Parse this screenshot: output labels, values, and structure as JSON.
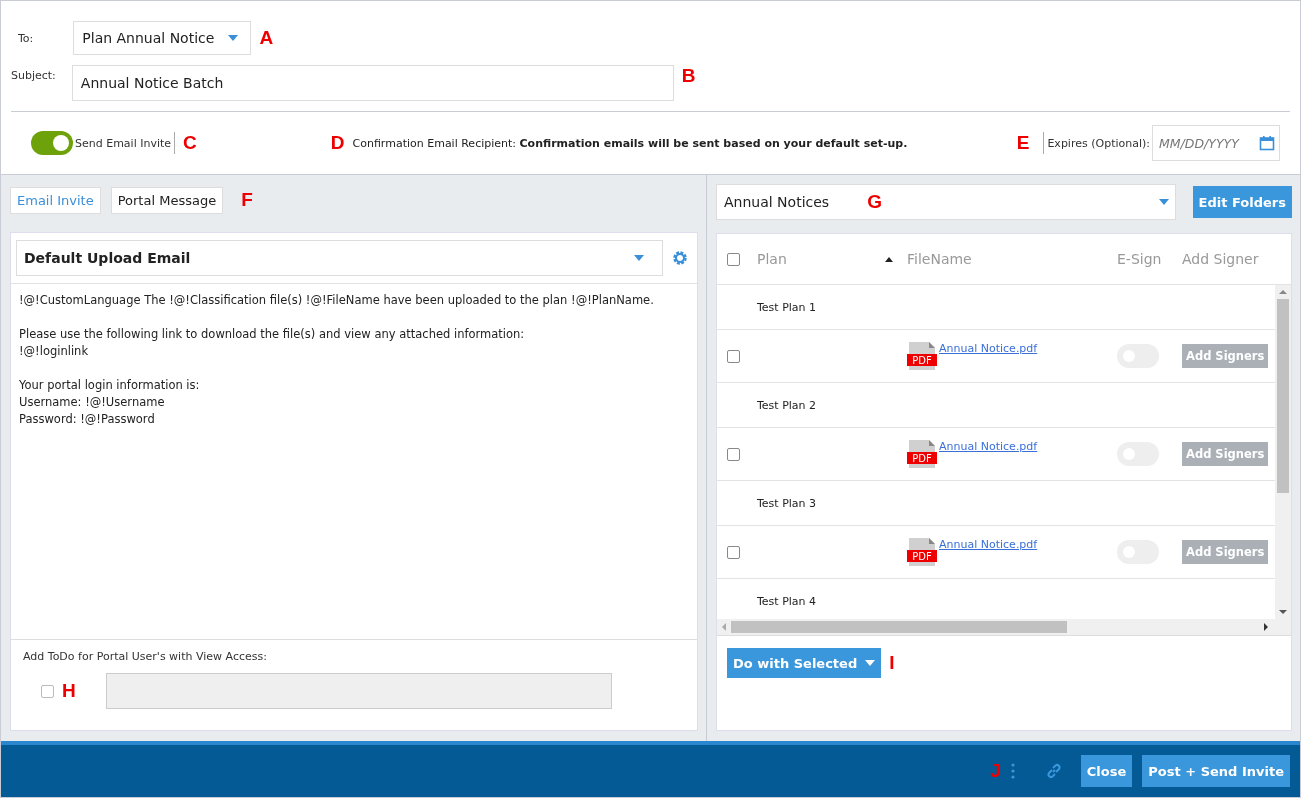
{
  "header": {
    "to_label": "To:",
    "to_value": "Plan Annual Notice",
    "subject_label": "Subject:",
    "subject_value": "Annual Notice Batch",
    "send_invite": {
      "label": "Send Email Invite",
      "on": true
    },
    "confirmation_label": "Confirmation Email Recipient:",
    "confirmation_text": "Confirmation emails will be sent based on your default set-up.",
    "expires_label": "Expires (Optional):",
    "expires_placeholder": "MM/DD/YYYY"
  },
  "callouts": [
    "A",
    "B",
    "C",
    "D",
    "E",
    "F",
    "G",
    "H",
    "I",
    "J"
  ],
  "tabs": [
    {
      "label": "Email Invite",
      "selected": true
    },
    {
      "label": "Portal Message",
      "selected": false
    }
  ],
  "template": {
    "value": "Default Upload Email",
    "body": "!@!CustomLanguage The !@!Classification file(s) !@!FileName have been uploaded to the plan !@!PlanName.\n\nPlease use the following link to download the file(s) and view any attached information:\n!@!loginlink\n\nYour portal login information is:\nUsername: !@!Username\nPassword: !@!Password"
  },
  "todo": {
    "label": "Add ToDo for Portal User's with View Access:",
    "checked": false
  },
  "folder": {
    "value": "Annual Notices",
    "edit_button": "Edit Folders"
  },
  "table": {
    "columns": [
      "Plan",
      "FileName",
      "E-Sign",
      "Add Signer"
    ],
    "select_all": false,
    "groups": [
      {
        "plan": "Test Plan 1",
        "files": [
          {
            "icon_label": "PDF",
            "filename": "Annual Notice.pdf",
            "checked": false,
            "esign": false,
            "action": "Add Signers"
          }
        ]
      },
      {
        "plan": "Test Plan 2",
        "files": [
          {
            "icon_label": "PDF",
            "filename": "Annual Notice.pdf",
            "checked": false,
            "esign": false,
            "action": "Add Signers"
          }
        ]
      },
      {
        "plan": "Test Plan 3",
        "files": [
          {
            "icon_label": "PDF",
            "filename": "Annual Notice.pdf",
            "checked": false,
            "esign": false,
            "action": "Add Signers"
          }
        ]
      },
      {
        "plan": "Test Plan 4"
      }
    ]
  },
  "do_with_selected": "Do with Selected",
  "footer": {
    "buttons": [
      "Close",
      "Post + Send Invite"
    ]
  }
}
